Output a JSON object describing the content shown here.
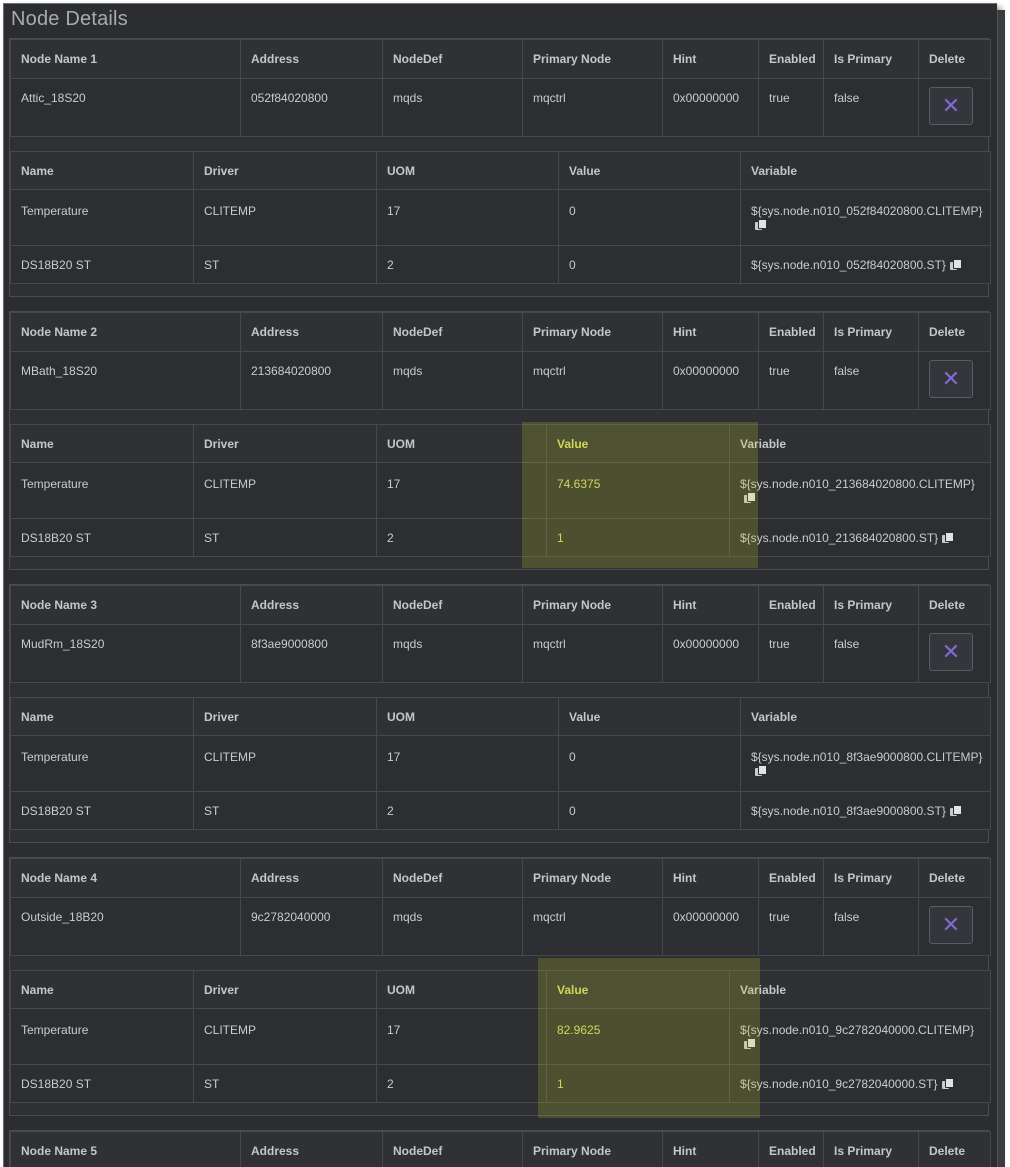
{
  "page": {
    "title": "Node Details"
  },
  "node_headers": [
    "Address",
    "NodeDef",
    "Primary Node",
    "Hint",
    "Enabled",
    "Is Primary",
    "Delete"
  ],
  "driver_headers": [
    "Name",
    "Driver",
    "UOM",
    "Value",
    "Variable"
  ],
  "nodes": [
    {
      "header": "Node Name 1",
      "name": "Attic_18S20",
      "address": "052f84020800",
      "nodedef": "mqds",
      "primary": "mqctrl",
      "hint": "0x00000000",
      "enabled": "true",
      "is_primary": "false",
      "drivers": [
        {
          "name": "Temperature",
          "driver": "CLITEMP",
          "uom": "17",
          "value": "0",
          "variable": "${sys.node.n010_052f84020800.CLITEMP}"
        },
        {
          "name": "DS18B20 ST",
          "driver": "ST",
          "uom": "2",
          "value": "0",
          "variable": "${sys.node.n010_052f84020800.ST}"
        }
      ]
    },
    {
      "header": "Node Name 2",
      "name": "MBath_18S20",
      "address": "213684020800",
      "nodedef": "mqds",
      "primary": "mqctrl",
      "hint": "0x00000000",
      "enabled": "true",
      "is_primary": "false",
      "drivers": [
        {
          "name": "Temperature",
          "driver": "CLITEMP",
          "uom": "17",
          "value": "74.6375",
          "variable": "${sys.node.n010_213684020800.CLITEMP}"
        },
        {
          "name": "DS18B20 ST",
          "driver": "ST",
          "uom": "2",
          "value": "1",
          "variable": "${sys.node.n010_213684020800.ST}"
        }
      ]
    },
    {
      "header": "Node Name 3",
      "name": "MudRm_18S20",
      "address": "8f3ae9000800",
      "nodedef": "mqds",
      "primary": "mqctrl",
      "hint": "0x00000000",
      "enabled": "true",
      "is_primary": "false",
      "drivers": [
        {
          "name": "Temperature",
          "driver": "CLITEMP",
          "uom": "17",
          "value": "0",
          "variable": "${sys.node.n010_8f3ae9000800.CLITEMP}"
        },
        {
          "name": "DS18B20 ST",
          "driver": "ST",
          "uom": "2",
          "value": "0",
          "variable": "${sys.node.n010_8f3ae9000800.ST}"
        }
      ]
    },
    {
      "header": "Node Name 4",
      "name": "Outside_18B20",
      "address": "9c2782040000",
      "nodedef": "mqds",
      "primary": "mqctrl",
      "hint": "0x00000000",
      "enabled": "true",
      "is_primary": "false",
      "drivers": [
        {
          "name": "Temperature",
          "driver": "CLITEMP",
          "uom": "17",
          "value": "82.9625",
          "variable": "${sys.node.n010_9c2782040000.CLITEMP}"
        },
        {
          "name": "DS18B20 ST",
          "driver": "ST",
          "uom": "2",
          "value": "1",
          "variable": "${sys.node.n010_9c2782040000.ST}"
        }
      ]
    },
    {
      "header": "Node Name 5"
    }
  ],
  "icons": {
    "delete": "close-x-icon",
    "copy": "copy-icon"
  },
  "colors": {
    "background": "#2b2d31",
    "delete_accent": "#7f6bd6",
    "highlight": "#bec828"
  }
}
